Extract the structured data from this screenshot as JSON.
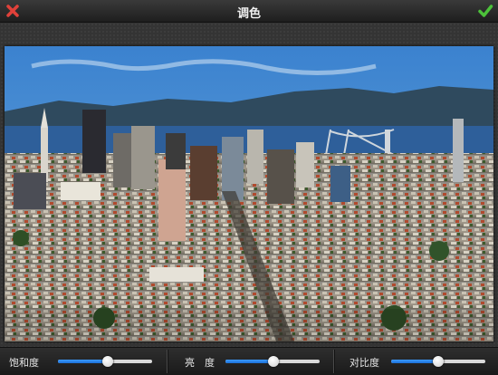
{
  "header": {
    "title": "调色",
    "cancel_icon": "close-icon",
    "confirm_icon": "check-icon",
    "cancel_color": "#e0413a",
    "confirm_color": "#4cc23a"
  },
  "photo": {
    "subject": "city-skyline-photo"
  },
  "controls": [
    {
      "label": "饱和度",
      "value": 0.53
    },
    {
      "label": "亮　度",
      "value": 0.51
    },
    {
      "label": "对比度",
      "value": 0.5
    }
  ],
  "colors": {
    "accent": "#2a86f0"
  }
}
